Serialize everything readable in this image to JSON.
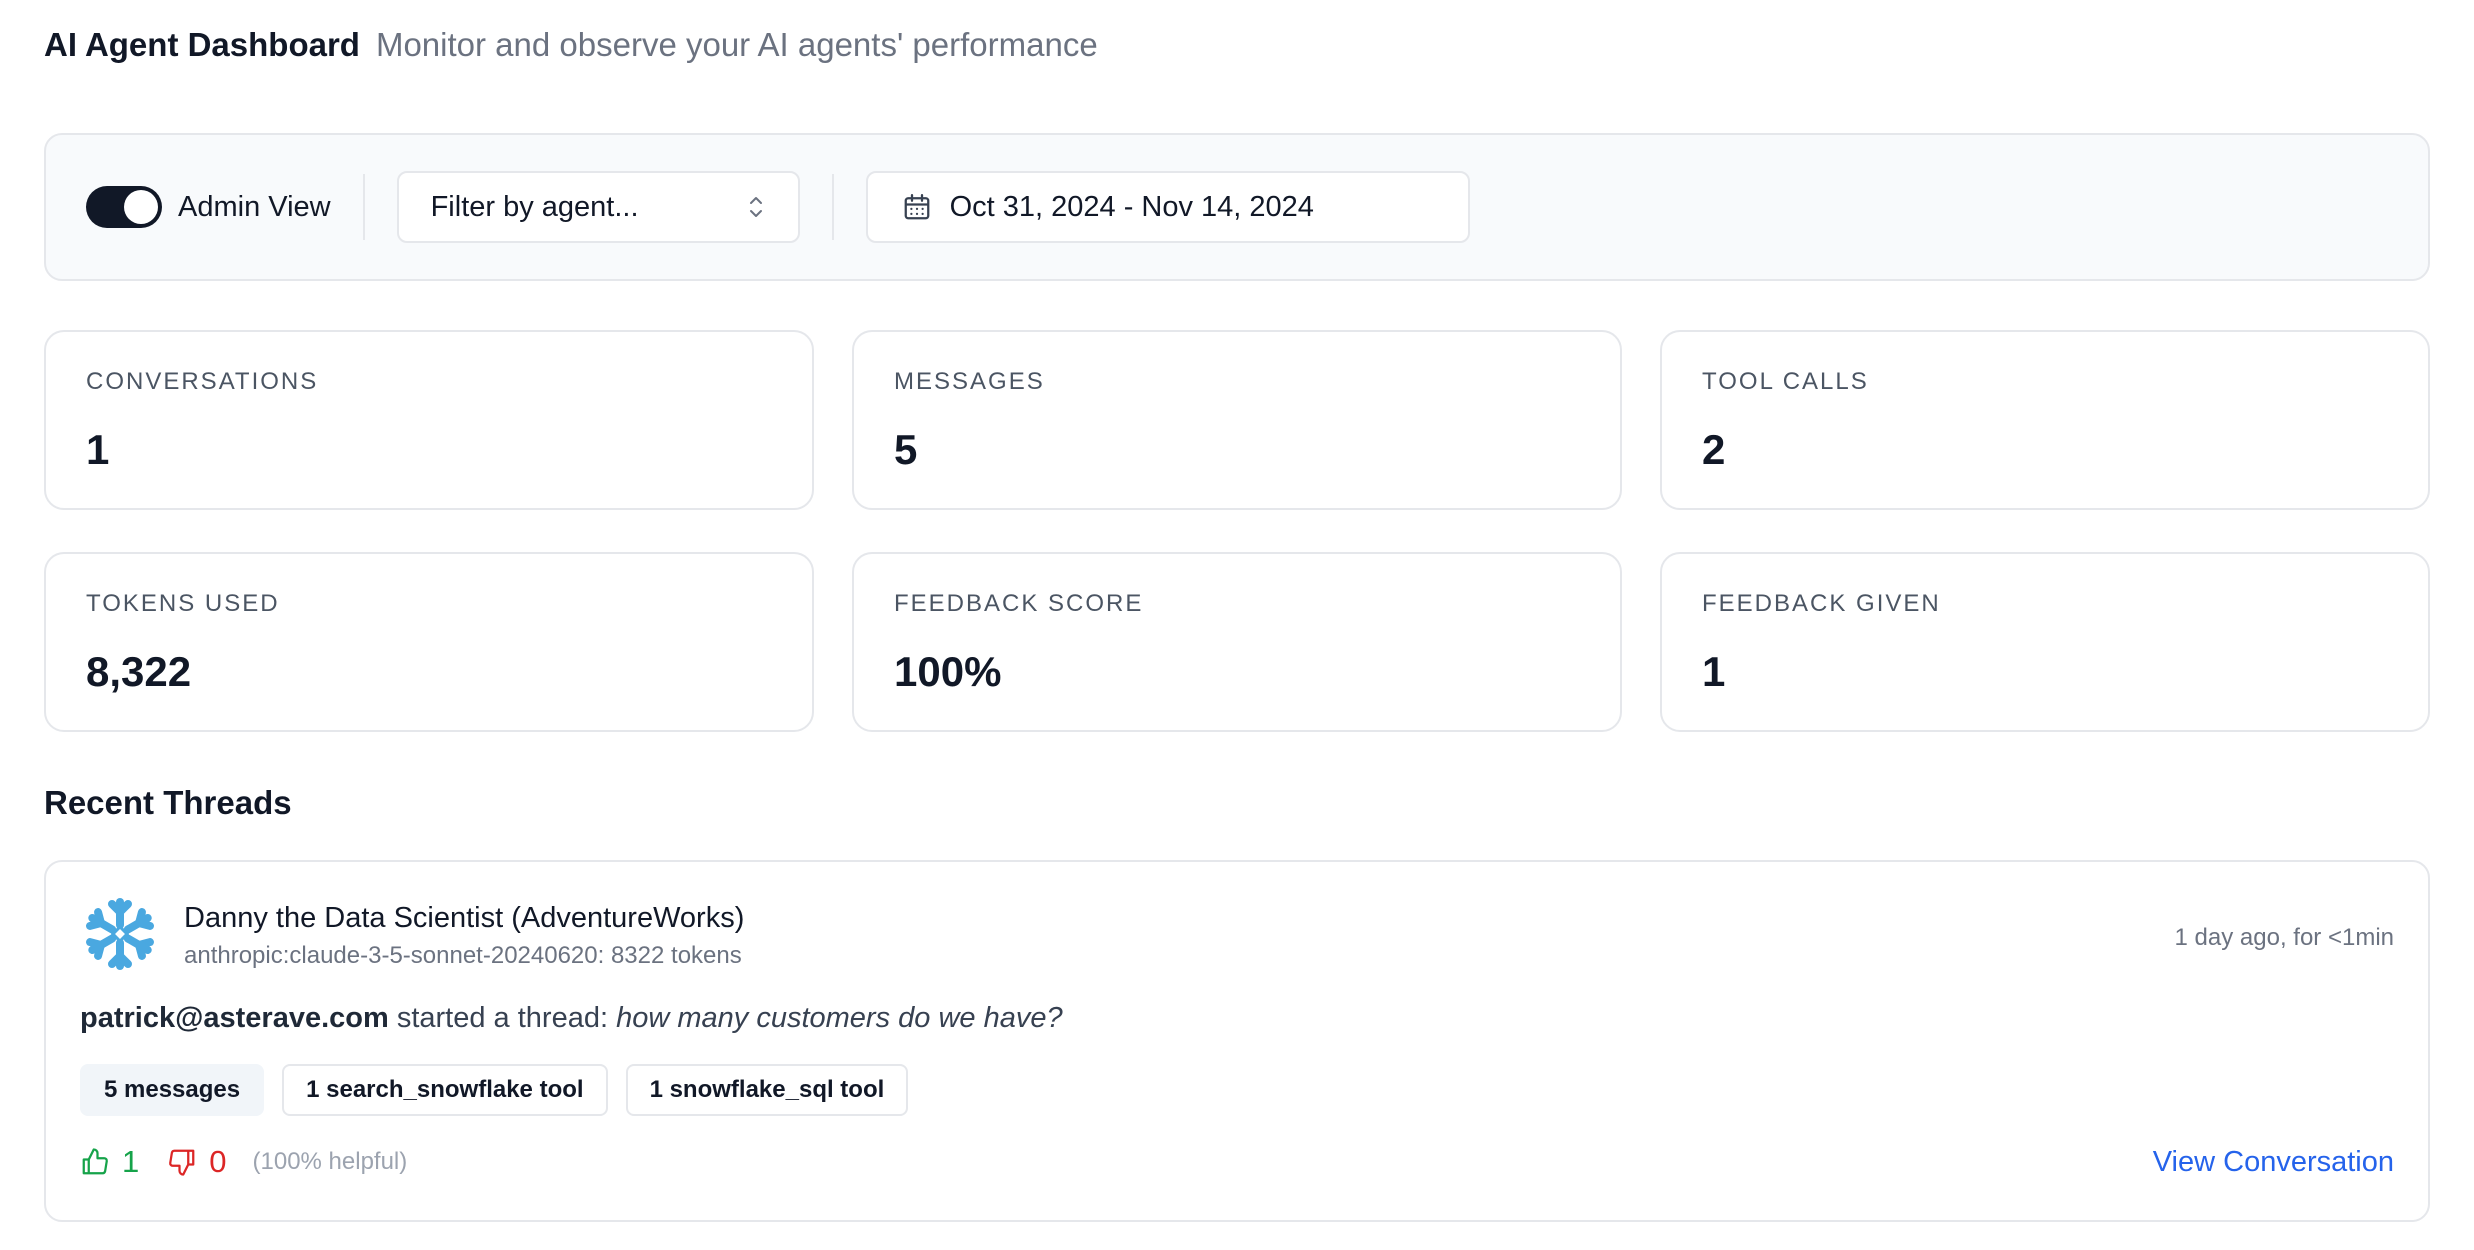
{
  "header": {
    "title": "AI Agent Dashboard",
    "subtitle": "Monitor and observe your AI agents' performance"
  },
  "toolbar": {
    "admin_toggle_label": "Admin View",
    "admin_toggle_on": true,
    "agent_filter_placeholder": "Filter by agent...",
    "date_range": "Oct 31, 2024 - Nov 14, 2024"
  },
  "stats": [
    {
      "label": "CONVERSATIONS",
      "value": "1"
    },
    {
      "label": "MESSAGES",
      "value": "5"
    },
    {
      "label": "TOOL CALLS",
      "value": "2"
    },
    {
      "label": "TOKENS USED",
      "value": "8,322"
    },
    {
      "label": "FEEDBACK SCORE",
      "value": "100%"
    },
    {
      "label": "FEEDBACK GIVEN",
      "value": "1"
    }
  ],
  "recent_threads": {
    "title": "Recent Threads",
    "items": [
      {
        "agent_name": "Danny the Data Scientist (AdventureWorks)",
        "agent_meta": "anthropic:claude-3-5-sonnet-20240620: 8322 tokens",
        "time": "1 day ago, for <1min",
        "user": "patrick@asterave.com",
        "started_text": " started a thread: ",
        "question": "how many customers do we have?",
        "tags": [
          "5 messages",
          "1 search_snowflake tool",
          "1 snowflake_sql tool"
        ],
        "thumbs_up": "1",
        "thumbs_down": "0",
        "helpful": "(100% helpful)",
        "view_label": "View Conversation",
        "logo_icon": "snowflake-icon"
      }
    ]
  },
  "colors": {
    "accent": "#2563eb",
    "positive": "#16a34a",
    "negative": "#dc2626",
    "toggle_on": "#111827",
    "snowflake": "#4aa8e0"
  }
}
